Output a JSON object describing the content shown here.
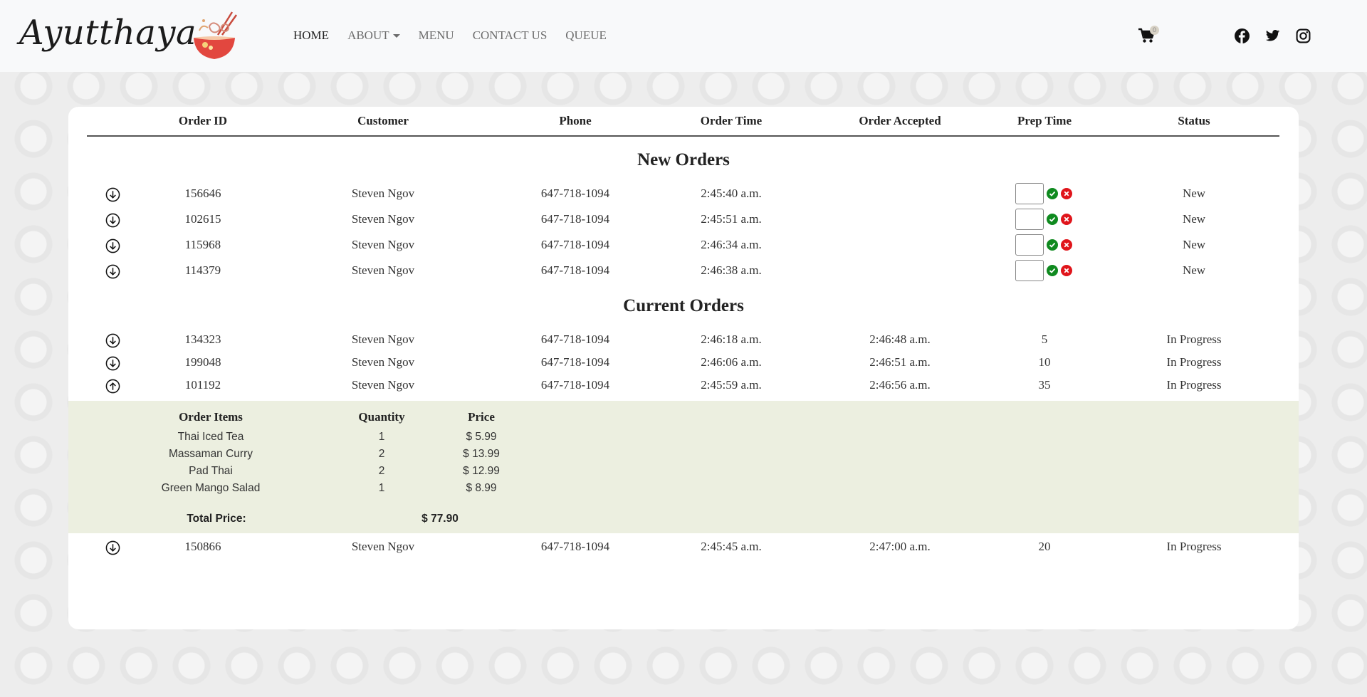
{
  "brand": {
    "name": "Ayutthaya"
  },
  "nav": {
    "links": [
      {
        "label": "HOME"
      },
      {
        "label": "ABOUT"
      },
      {
        "label": "MENU"
      },
      {
        "label": "CONTACT US"
      },
      {
        "label": "QUEUE"
      }
    ],
    "cart_count": "0"
  },
  "table": {
    "headers": [
      "Order ID",
      "Customer",
      "Phone",
      "Order Time",
      "Order Accepted",
      "Prep Time",
      "Status"
    ]
  },
  "new_orders": {
    "title": "New Orders",
    "rows": [
      {
        "id": "156646",
        "customer": "Steven Ngov",
        "phone": "647-718-1094",
        "time": "2:45:40 a.m.",
        "status": "New"
      },
      {
        "id": "102615",
        "customer": "Steven Ngov",
        "phone": "647-718-1094",
        "time": "2:45:51 a.m.",
        "status": "New"
      },
      {
        "id": "115968",
        "customer": "Steven Ngov",
        "phone": "647-718-1094",
        "time": "2:46:34 a.m.",
        "status": "New"
      },
      {
        "id": "114379",
        "customer": "Steven Ngov",
        "phone": "647-718-1094",
        "time": "2:46:38 a.m.",
        "status": "New"
      }
    ]
  },
  "current_orders": {
    "title": "Current Orders",
    "rows": [
      {
        "id": "134323",
        "customer": "Steven Ngov",
        "phone": "647-718-1094",
        "time": "2:46:18 a.m.",
        "accepted": "2:46:48 a.m.",
        "prep": "5",
        "status": "In Progress"
      },
      {
        "id": "199048",
        "customer": "Steven Ngov",
        "phone": "647-718-1094",
        "time": "2:46:06 a.m.",
        "accepted": "2:46:51 a.m.",
        "prep": "10",
        "status": "In Progress"
      },
      {
        "id": "101192",
        "customer": "Steven Ngov",
        "phone": "647-718-1094",
        "time": "2:45:59 a.m.",
        "accepted": "2:46:56 a.m.",
        "prep": "35",
        "status": "In Progress"
      },
      {
        "id": "150866",
        "customer": "Steven Ngov",
        "phone": "647-718-1094",
        "time": "2:45:45 a.m.",
        "accepted": "2:47:00 a.m.",
        "prep": "20",
        "status": "In Progress"
      }
    ],
    "expanded_detail": {
      "headers": [
        "Order Items",
        "Quantity",
        "Price"
      ],
      "items": [
        {
          "name": "Thai Iced Tea",
          "qty": "1",
          "price": "$ 5.99"
        },
        {
          "name": "Massaman Curry",
          "qty": "2",
          "price": "$ 13.99"
        },
        {
          "name": "Pad Thai",
          "qty": "2",
          "price": "$ 12.99"
        },
        {
          "name": "Green Mango Salad",
          "qty": "1",
          "price": "$ 8.99"
        }
      ],
      "total_label": "Total Price:",
      "total_value": "$ 77.90"
    }
  },
  "colors": {
    "navbar_bg": "#f8f9fa",
    "accept_green": "#0f8a1f",
    "reject_red": "#e0151b",
    "detail_bg": "#ecefe0"
  },
  "icons": {
    "toggle_collapsed": "arrow-down-circle-icon",
    "toggle_expanded": "arrow-up-circle-icon",
    "accept": "check-circle-icon",
    "reject": "x-circle-icon",
    "cart": "cart-icon",
    "social": [
      "facebook-icon",
      "twitter-icon",
      "instagram-icon"
    ]
  }
}
